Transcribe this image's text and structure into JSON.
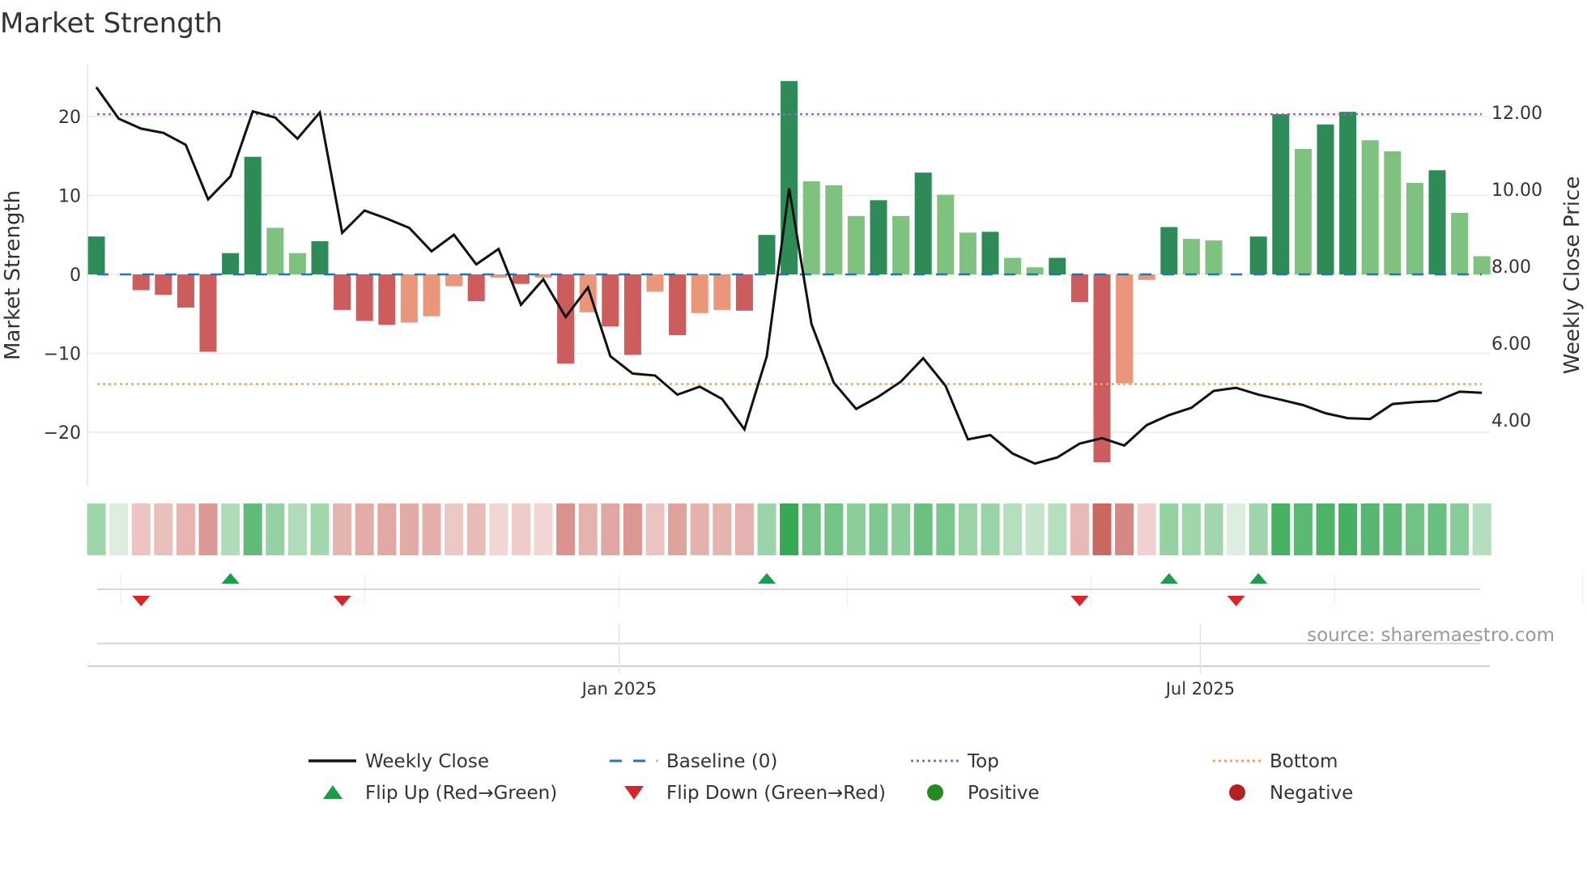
{
  "title": "Market Strength",
  "source": "source: sharemaestro.com",
  "colors": {
    "dark_green": "#2e8b57",
    "light_green": "#7fc27f",
    "red": "#cd5c5c",
    "salmon": "#e9967a",
    "weekly_close": "#111111",
    "baseline": "#1f77b4",
    "top": "#9467bd",
    "bottom": "#f4a460",
    "flip_up": "#1a9e4a",
    "flip_down": "#d62728",
    "positive": "#228b22",
    "negative": "#b22222"
  },
  "chart_data": {
    "type": "bar",
    "title": "Market Strength",
    "ylabel": "Market Strength",
    "y2label": "Weekly Close Price",
    "ylim": [
      -26,
      25
    ],
    "y2lim": [
      2.5,
      13.2
    ],
    "yticks": [
      20,
      10,
      0,
      -10,
      -20
    ],
    "ytick_labels": [
      "20",
      "10",
      "0",
      "−10",
      "−20"
    ],
    "y2ticks": [
      12,
      10,
      8,
      6,
      4
    ],
    "y2tick_labels": [
      "12.00",
      "10.00",
      "8.00",
      "6.00",
      "4.00"
    ],
    "x_tick_labels": [
      {
        "label": "Jan 2025",
        "week_index": 23.4
      },
      {
        "label": "Jul 2025",
        "week_index": 49.4
      }
    ],
    "month_gridlines_week_index": [
      1.1,
      12,
      23.4,
      33.6,
      44.5,
      55.4,
      66.5,
      77.2
    ],
    "top_level": 20.3,
    "bottom_level": -13.9,
    "baseline": 0,
    "strength": [
      4.8,
      0,
      -2,
      -2.6,
      -4.2,
      -9.8,
      2.7,
      14.9,
      5.9,
      2.7,
      4.2,
      -4.5,
      -5.9,
      -6.4,
      -6.1,
      -5.3,
      -1.5,
      -3.4,
      -0.4,
      -1.2,
      -0.4,
      -11.3,
      -4.8,
      -6.6,
      -10.2,
      -2.2,
      -7.7,
      -4.9,
      -4.5,
      -4.6,
      5.0,
      24.5,
      11.8,
      11.3,
      7.4,
      9.4,
      7.4,
      12.9,
      10.1,
      5.3,
      5.4,
      2.1,
      0.9,
      2.1,
      -3.5,
      -23.8,
      -13.8,
      -0.7,
      6.0,
      4.5,
      4.3,
      0,
      4.8,
      20.3,
      15.9,
      19.0,
      20.6,
      17.0,
      15.6,
      11.6,
      13.2,
      7.8,
      2.3
    ],
    "bar_shade": [
      "d",
      "d",
      "r",
      "r",
      "r",
      "r",
      "d",
      "d",
      "l",
      "l",
      "d",
      "r",
      "r",
      "r",
      "s",
      "s",
      "s",
      "r",
      "s",
      "r",
      "s",
      "r",
      "s",
      "r",
      "r",
      "s",
      "r",
      "s",
      "s",
      "r",
      "d",
      "d",
      "l",
      "l",
      "l",
      "d",
      "l",
      "d",
      "l",
      "l",
      "d",
      "l",
      "l",
      "d",
      "r",
      "r",
      "s",
      "s",
      "d",
      "l",
      "l",
      "d",
      "d",
      "d",
      "l",
      "d",
      "d",
      "l",
      "l",
      "l",
      "d",
      "l",
      "l"
    ],
    "weekly_close": [
      12.66,
      11.84,
      11.58,
      11.47,
      11.16,
      9.74,
      10.34,
      12.03,
      11.87,
      11.32,
      12.0,
      8.87,
      9.45,
      9.24,
      9.0,
      8.39,
      8.82,
      8.05,
      8.45,
      7.0,
      7.66,
      6.68,
      7.45,
      5.66,
      5.21,
      5.16,
      4.66,
      4.87,
      4.55,
      3.76,
      5.66,
      10.03,
      6.5,
      4.97,
      4.29,
      4.61,
      5.0,
      5.61,
      4.89,
      3.5,
      3.61,
      3.13,
      2.87,
      3.03,
      3.39,
      3.53,
      3.34,
      3.87,
      4.13,
      4.32,
      4.76,
      4.84,
      4.66,
      4.53,
      4.39,
      4.18,
      4.05,
      4.03,
      4.42,
      4.47,
      4.5,
      4.74,
      4.71
    ],
    "flip_up_indices": [
      6,
      30,
      48,
      52
    ],
    "flip_down_indices": [
      2,
      11,
      44,
      51
    ],
    "legend": [
      {
        "label": "Weekly Close",
        "kind": "line"
      },
      {
        "label": "Baseline (0)",
        "kind": "dash"
      },
      {
        "label": "Top",
        "kind": "dot-top"
      },
      {
        "label": "Bottom",
        "kind": "dot-bottom"
      },
      {
        "label": "Flip Up (Red→Green)",
        "kind": "tri-up"
      },
      {
        "label": "Flip Down (Green→Red)",
        "kind": "tri-down"
      },
      {
        "label": "Positive",
        "kind": "dot-pos"
      },
      {
        "label": "Negative",
        "kind": "dot-neg"
      }
    ],
    "legend_placement": "bottom"
  }
}
